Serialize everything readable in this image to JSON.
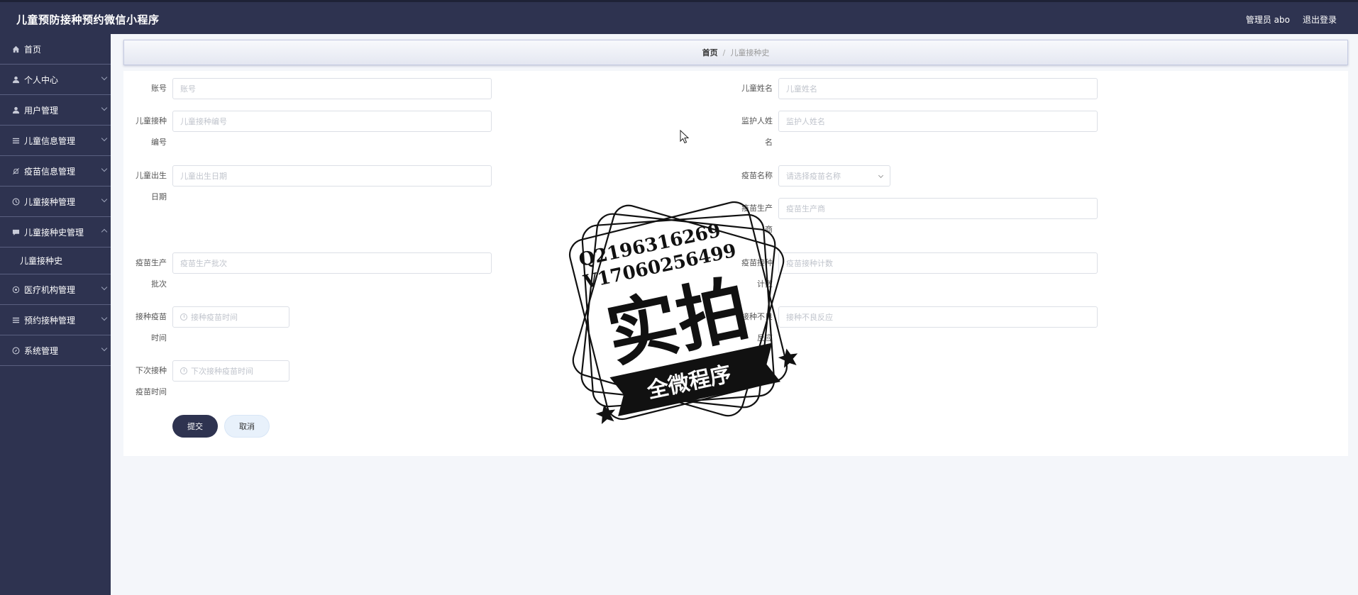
{
  "app": {
    "title": "儿童预防接种预约微信小程序"
  },
  "header": {
    "user_label": "管理员 abo",
    "logout_label": "退出登录"
  },
  "sidebar": {
    "items": [
      {
        "label": "首页",
        "icon": "home-icon"
      },
      {
        "label": "个人中心",
        "icon": "user-icon"
      },
      {
        "label": "用户管理",
        "icon": "user-icon"
      },
      {
        "label": "儿童信息管理",
        "icon": "list-icon"
      },
      {
        "label": "疫苗信息管理",
        "icon": "bell-off-icon"
      },
      {
        "label": "儿童接种管理",
        "icon": "clock-icon"
      },
      {
        "label": "儿童接种史管理",
        "icon": "chat-icon",
        "expanded": true,
        "sub": [
          {
            "label": "儿童接种史"
          }
        ]
      },
      {
        "label": "医疗机构管理",
        "icon": "gear-icon"
      },
      {
        "label": "预约接种管理",
        "icon": "list-icon"
      },
      {
        "label": "系统管理",
        "icon": "compass-icon"
      }
    ]
  },
  "breadcrumb": {
    "home": "首页",
    "separator": "/",
    "current": "儿童接种史"
  },
  "form": {
    "account": {
      "label": "账号",
      "placeholder": "账号"
    },
    "child_name": {
      "label": "儿童姓名",
      "placeholder": "儿童姓名"
    },
    "vacc_no": {
      "label_1": "儿童接种",
      "label_2": "编号",
      "placeholder": "儿童接种编号"
    },
    "guardian": {
      "label_1": "监护人姓",
      "label_2": "名",
      "placeholder": "监护人姓名"
    },
    "birth": {
      "label_1": "儿童出生",
      "label_2": "日期",
      "placeholder": "儿童出生日期"
    },
    "vaccine_name": {
      "label": "疫苗名称",
      "placeholder": "请选择疫苗名称"
    },
    "manufacturer": {
      "label_1": "疫苗生产",
      "label_2": "商",
      "placeholder": "疫苗生产商"
    },
    "batch": {
      "label_1": "疫苗生产",
      "label_2": "批次",
      "placeholder": "疫苗生产批次"
    },
    "dose": {
      "label_1": "疫苗接种",
      "label_2": "计数",
      "placeholder": "疫苗接种计数"
    },
    "vacc_time": {
      "label_1": "接种疫苗",
      "label_2": "时间",
      "placeholder": "接种疫苗时间"
    },
    "adverse": {
      "label_1": "接种不良",
      "label_2": "反应",
      "placeholder": "接种不良反应"
    },
    "next_time": {
      "label_1": "下次接种",
      "label_2": "疫苗时间",
      "placeholder": "下次接种疫苗时间"
    },
    "submit_label": "提交",
    "cancel_label": "取消"
  },
  "watermark": {
    "line1": "Q2196316269",
    "line2": "V17060256499",
    "big": "实拍",
    "banner": "全微程序"
  }
}
